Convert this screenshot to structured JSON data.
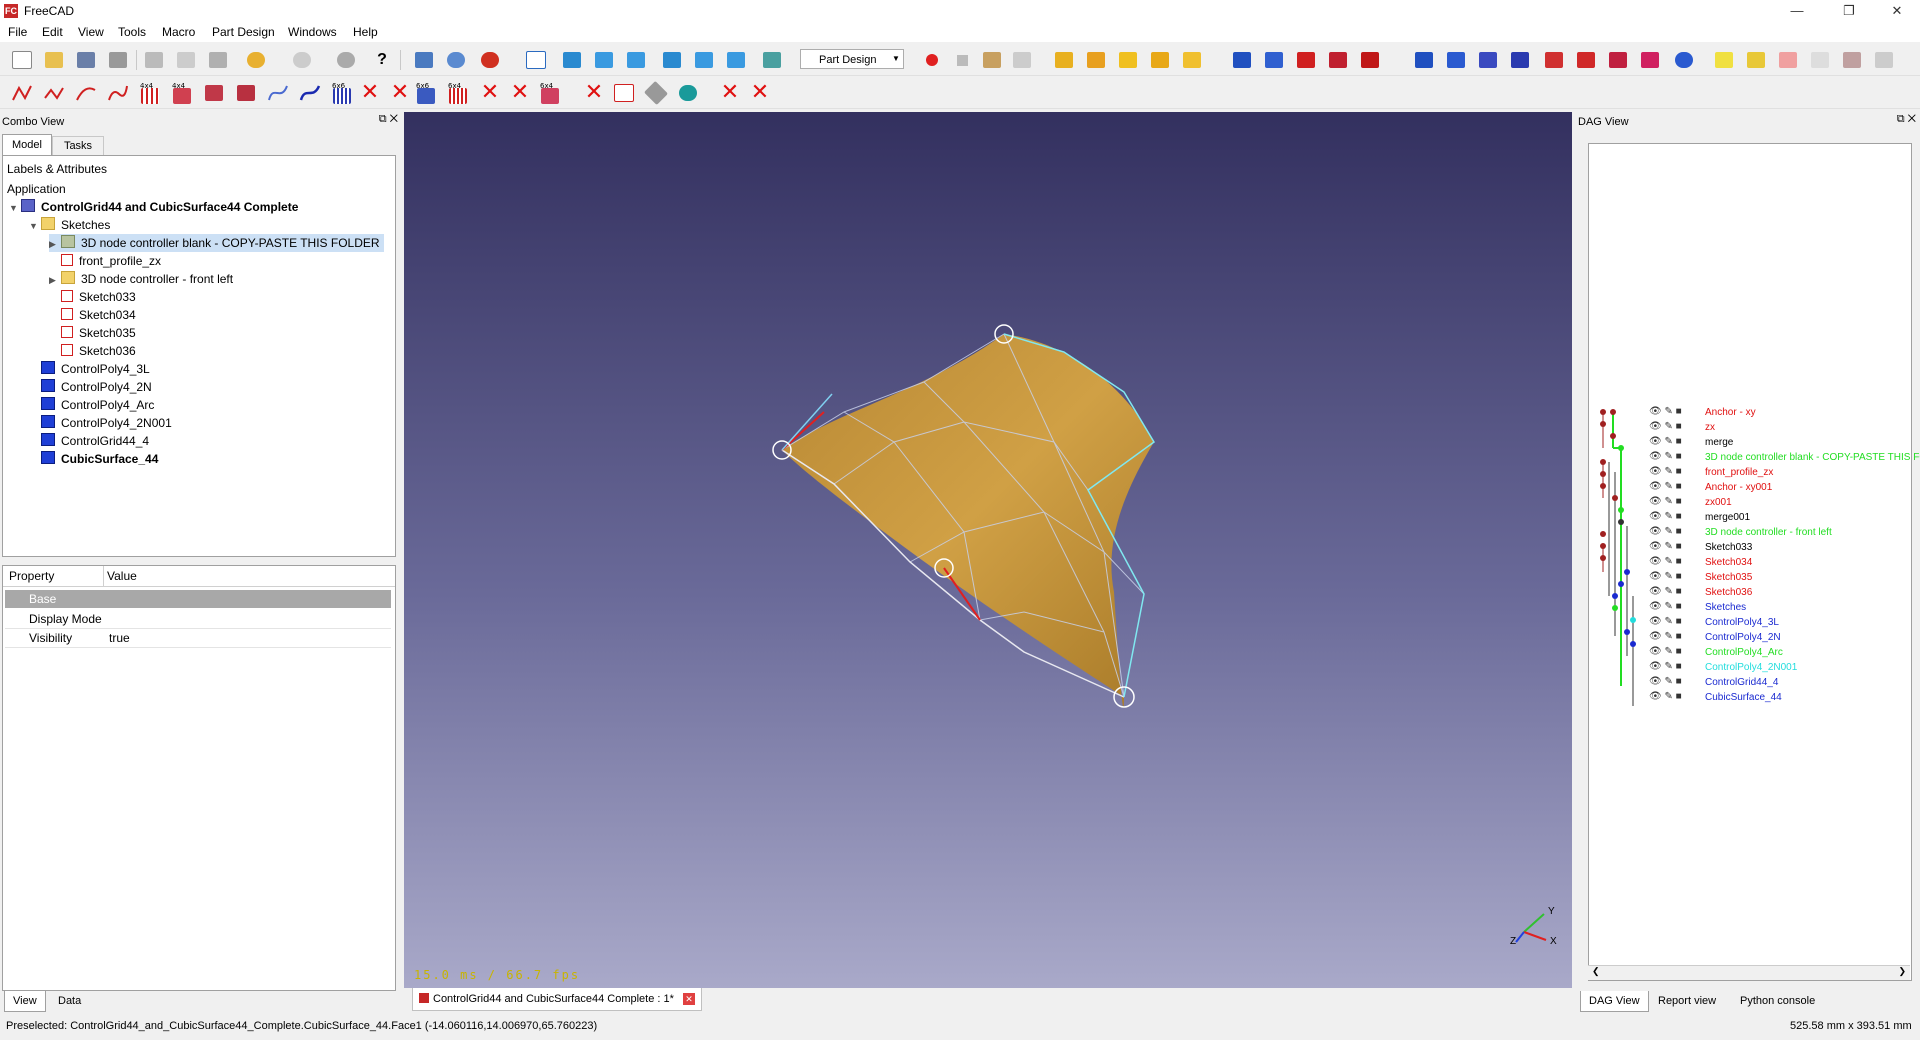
{
  "window": {
    "title": "FreeCAD",
    "logo": "FC"
  },
  "menu": [
    "File",
    "Edit",
    "View",
    "Tools",
    "Macro",
    "Part Design",
    "Windows",
    "Help"
  ],
  "toolbar": {
    "workbench": "Part Design",
    "labels": {
      "a": "4x4",
      "b": "4x4",
      "c": "6x6",
      "d": "6x6",
      "e": "6x4",
      "f": "6x4"
    }
  },
  "combo": {
    "title": "Combo View",
    "tabs": [
      "Model",
      "Tasks"
    ],
    "tree_header": "Labels & Attributes",
    "application": "Application",
    "document": "ControlGrid44 and CubicSurface44 Complete",
    "items": [
      {
        "label": "Sketches",
        "icon": "folder-icon"
      },
      {
        "label": "3D node controller blank - COPY-PASTE THIS FOLDER",
        "icon": "group-icon"
      },
      {
        "label": "front_profile_zx",
        "icon": "sketch-icon"
      },
      {
        "label": "3D node controller - front left",
        "icon": "folder-icon"
      },
      {
        "label": "Sketch033",
        "icon": "sketch-icon"
      },
      {
        "label": "Sketch034",
        "icon": "sketch-icon"
      },
      {
        "label": "Sketch035",
        "icon": "sketch-icon"
      },
      {
        "label": "Sketch036",
        "icon": "sketch-icon"
      },
      {
        "label": "ControlPoly4_3L",
        "icon": "body-icon"
      },
      {
        "label": "ControlPoly4_2N",
        "icon": "body-icon"
      },
      {
        "label": "ControlPoly4_Arc",
        "icon": "body-icon"
      },
      {
        "label": "ControlPoly4_2N001",
        "icon": "body-icon"
      },
      {
        "label": "ControlGrid44_4",
        "icon": "body-icon"
      },
      {
        "label": "CubicSurface_44",
        "icon": "body-icon"
      }
    ],
    "props": {
      "col_property": "Property",
      "col_value": "Value",
      "group": "Base",
      "rows": [
        {
          "name": "Display Mode",
          "value": ""
        },
        {
          "name": "Visibility",
          "value": "true"
        }
      ]
    },
    "bottom_tabs": [
      "View",
      "Data"
    ]
  },
  "viewport": {
    "fps": "15.0 ms / 66.7 fps",
    "axis": {
      "x": "X",
      "y": "Y",
      "z": "Z"
    }
  },
  "doc_tab": "ControlGrid44 and CubicSurface44 Complete : 1*",
  "dag": {
    "title": "DAG View",
    "rows": [
      {
        "label": "Anchor - xy",
        "color": "#e01010"
      },
      {
        "label": "zx",
        "color": "#e01010"
      },
      {
        "label": "merge",
        "color": "#000000"
      },
      {
        "label": "3D node controller blank - COPY-PASTE THIS FOLDER",
        "color": "#22dd22"
      },
      {
        "label": "front_profile_zx",
        "color": "#e01010"
      },
      {
        "label": "Anchor - xy001",
        "color": "#e01010"
      },
      {
        "label": "zx001",
        "color": "#e01010"
      },
      {
        "label": "merge001",
        "color": "#000000"
      },
      {
        "label": "3D node controller - front left",
        "color": "#22dd22"
      },
      {
        "label": "Sketch033",
        "color": "#000000"
      },
      {
        "label": "Sketch034",
        "color": "#e01010"
      },
      {
        "label": "Sketch035",
        "color": "#e01010"
      },
      {
        "label": "Sketch036",
        "color": "#e01010"
      },
      {
        "label": "Sketches",
        "color": "#1a2ad0"
      },
      {
        "label": "ControlPoly4_3L",
        "color": "#1a2ad0"
      },
      {
        "label": "ControlPoly4_2N",
        "color": "#1a2ad0"
      },
      {
        "label": "ControlPoly4_Arc",
        "color": "#22dd22"
      },
      {
        "label": "ControlPoly4_2N001",
        "color": "#22dddd"
      },
      {
        "label": "ControlGrid44_4",
        "color": "#1a2ad0"
      },
      {
        "label": "CubicSurface_44",
        "color": "#1a2ad0"
      }
    ],
    "bottom_tabs": [
      "DAG View",
      "Report view",
      "Python console"
    ]
  },
  "status": {
    "preselected": "Preselected: ControlGrid44_and_CubicSurface44_Complete.CubicSurface_44.Face1 (-14.060116,14.006970,65.760223)",
    "dimensions": "525.58 mm x 393.51 mm"
  }
}
